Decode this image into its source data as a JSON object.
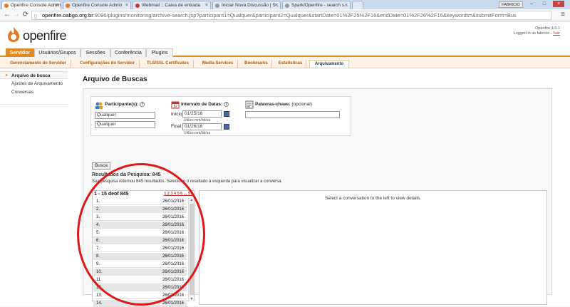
{
  "browser": {
    "tabs": [
      {
        "label": "Openfire Console Admin"
      },
      {
        "label": "Openfire Console Admin"
      },
      {
        "label": "Webmail :: Caixa de entrada"
      },
      {
        "label": "Iniciar Nova Discussão | S..."
      },
      {
        "label": "Spark/Openfire - search s..."
      }
    ],
    "user_chip": "FABRICIO",
    "url_host": "openfire.oabgo.org.br",
    "url_path": ":9090/plugins/monitoring/archive-search.jsp?participant1=Qualquer&participant2=Qualquer&startDate=01%2F25%2F16&endDate=01%2F26%2F16&keywords=&submitForm=Bus"
  },
  "header": {
    "logo_text": "openfire",
    "version": "Openfire 4.0.1",
    "logged_in": "Logged in as fabricio -",
    "logout": "Sair"
  },
  "main_nav": [
    "Servidor",
    "Usuários/Grupos",
    "Sessões",
    "Conferência",
    "Plugins"
  ],
  "sub_nav": [
    "Gerenciamento do Servidor",
    "Configurações do Servidor",
    "TLS/SSL Certificates",
    "Media Services",
    "Bookmarks",
    "Estatísticas",
    "Arquivamento"
  ],
  "sidebar": [
    "Arquivo de busca",
    "Ajustes de Arquivamento",
    "Conversas"
  ],
  "page": {
    "title": "Arquivo de Buscas",
    "participants_label": "Participante(s):",
    "participant1": "Qualquer",
    "participant2": "Qualquer",
    "date_label": "Intervalo de Datas:",
    "start_label": "Início:",
    "start_value": "01/25/16",
    "end_label": "Final:",
    "end_value": "01/26/16",
    "date_hint": "Utilize mm/dd/aa",
    "keywords_label": "Palavras-chave:",
    "keywords_optional": "(opcional)",
    "search_button": "Busca",
    "results_title": "Resultados da Pesquisa: 845",
    "results_desc": "Sua pesquisa retornou 845 resultados. Selecione o resultado à esquerda para visualizar a conversa.",
    "results_range": "1 - 15 deof 845",
    "pages": "1 2 3 4 5 6 ... 57",
    "detail_placeholder": "Select a conversation to the left to view details."
  },
  "results": [
    {
      "n": "1.",
      "date": "26/01/2016"
    },
    {
      "n": "2.",
      "date": "26/01/2016"
    },
    {
      "n": "3.",
      "date": "26/01/2016"
    },
    {
      "n": "4.",
      "date": "26/01/2016"
    },
    {
      "n": "5.",
      "date": "26/01/2016"
    },
    {
      "n": "6.",
      "date": "26/01/2016"
    },
    {
      "n": "7.",
      "date": "26/01/2016"
    },
    {
      "n": "8.",
      "date": "26/01/2016"
    },
    {
      "n": "9.",
      "date": "26/01/2016"
    },
    {
      "n": "10.",
      "date": "26/01/2016"
    },
    {
      "n": "11.",
      "date": "26/01/2016"
    },
    {
      "n": "12.",
      "date": "26/01/2016"
    },
    {
      "n": "13.",
      "date": "26/01/2016"
    },
    {
      "n": "14.",
      "date": "26/01/2016"
    }
  ],
  "colors": {
    "accent": "#e08a22",
    "annotation": "#e01818"
  }
}
